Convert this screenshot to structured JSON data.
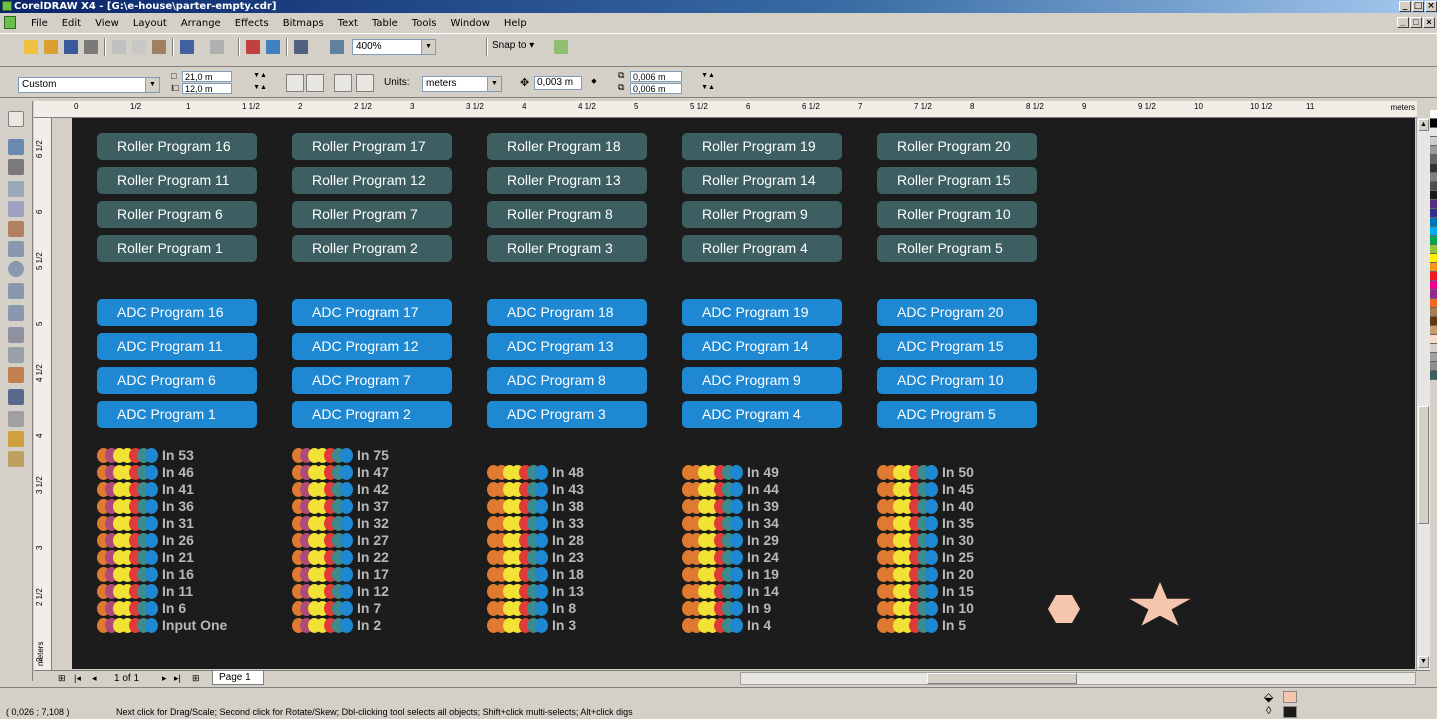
{
  "window": {
    "title": "CorelDRAW X4 - [G:\\e-house\\parter-empty.cdr]",
    "window_buttons": [
      "_",
      "□",
      "×"
    ]
  },
  "menu": [
    "File",
    "Edit",
    "View",
    "Layout",
    "Arrange",
    "Effects",
    "Bitmaps",
    "Text",
    "Table",
    "Tools",
    "Window",
    "Help"
  ],
  "toolbar": {
    "zoom": "400%",
    "snap_to": "Snap to"
  },
  "property_bar": {
    "paper_size": "Custom",
    "width": "21,0 m",
    "height": "12,0 m",
    "units_label": "Units:",
    "units_value": "meters",
    "nudge": "0,003 m",
    "dup_x": "0,006 m",
    "dup_y": "0,006 m"
  },
  "ruler": {
    "h_ticks": [
      "0",
      "1/2",
      "1",
      "1 1/2",
      "2",
      "2 1/2",
      "3",
      "3 1/2",
      "4",
      "4 1/2",
      "5",
      "5 1/2",
      "6",
      "6 1/2",
      "7",
      "7 1/2",
      "8",
      "8 1/2",
      "9",
      "9 1/2",
      "10",
      "10 1/2",
      "11"
    ],
    "units": "meters",
    "v_ticks": [
      "6 1/2",
      "6",
      "5 1/2",
      "5",
      "4 1/2",
      "4",
      "3 1/2",
      "3",
      "2 1/2",
      "2"
    ],
    "v_units": "meters"
  },
  "roller_rows": [
    [
      "Roller Program 16",
      "Roller Program 17",
      "Roller Program 18",
      "Roller Program 19",
      "Roller Program 20"
    ],
    [
      "Roller Program 11",
      "Roller Program 12",
      "Roller Program 13",
      "Roller Program 14",
      "Roller Program 15"
    ],
    [
      "Roller Program 6",
      "Roller Program 7",
      "Roller Program 8",
      "Roller Program 9",
      "Roller Program 10"
    ],
    [
      "Roller Program 1",
      "Roller Program 2",
      "Roller Program 3",
      "Roller Program 4",
      "Roller Program 5"
    ]
  ],
  "adc_rows": [
    [
      "ADC Program 16",
      "ADC Program 17",
      "ADC Program 18",
      "ADC Program 19",
      "ADC Program 20"
    ],
    [
      "ADC Program 11",
      "ADC Program 12",
      "ADC Program 13",
      "ADC Program 14",
      "ADC Program 15"
    ],
    [
      "ADC Program 6",
      "ADC Program 7",
      "ADC Program 8",
      "ADC Program 9",
      "ADC Program 10"
    ],
    [
      "ADC Program 1",
      "ADC Program 2",
      "ADC Program 3",
      "ADC Program 4",
      "ADC Program 5"
    ]
  ],
  "input_columns": [
    [
      "In 53",
      "In 46",
      "In 41",
      "In 36",
      "In 31",
      "In 26",
      "In 21",
      "In 16",
      "In 11",
      "In 6",
      "Input One"
    ],
    [
      "In 75",
      "In 47",
      "In 42",
      "In 37",
      "In 32",
      "In 27",
      "In 22",
      "In 17",
      "In 12",
      "In 7",
      "In 2"
    ],
    [
      "In 48",
      "In 43",
      "In 38",
      "In 33",
      "In 28",
      "In 23",
      "In 18",
      "In 13",
      "In 8",
      "In 3"
    ],
    [
      "In 49",
      "In 44",
      "In 39",
      "In 34",
      "In 29",
      "In 24",
      "In 19",
      "In 14",
      "In 9",
      "In 4"
    ],
    [
      "In 50",
      "In 45",
      "In 40",
      "In 35",
      "In 30",
      "In 25",
      "In 20",
      "In 15",
      "In 10",
      "In 5"
    ]
  ],
  "dot_colors_by_column": [
    [
      "#e07a30",
      "#b04a7a",
      "#f2e236",
      "#f2e236",
      "#e03a3a",
      "#3d8b8b",
      "#1e88d2"
    ],
    [
      "#e07a30",
      "#b04a7a",
      "#f2e236",
      "#f2e236",
      "#e03a3a",
      "#3d8b8b",
      "#1e88d2"
    ],
    [
      "#e07a30",
      "#e07a30",
      "#f2e236",
      "#f2e236",
      "#e03a3a",
      "#3d8b8b",
      "#1e88d2"
    ],
    [
      "#e07a30",
      "#e07a30",
      "#f2e236",
      "#f2e236",
      "#e03a3a",
      "#3d8b8b",
      "#1e88d2"
    ],
    [
      "#e07a30",
      "#e07a30",
      "#f2e236",
      "#f2e236",
      "#e03a3a",
      "#3d8b8b",
      "#1e88d2"
    ]
  ],
  "colors": {
    "canvas_bg": "#1c1c1c",
    "roller": "#3d5f61",
    "adc": "#1e88d2",
    "shape_fill": "#f5c5ad"
  },
  "palette": [
    "#ffffff",
    "#000000",
    "#e6e6e6",
    "#cccccc",
    "#999999",
    "#666666",
    "#333333",
    "#7f7f7f",
    "#4d4d4d",
    "#1a1a1a",
    "#5a2d82",
    "#2e3192",
    "#0072bc",
    "#00aeef",
    "#00a651",
    "#8dc63f",
    "#fff200",
    "#f7941d",
    "#ed1c24",
    "#ec008c",
    "#92278f",
    "#f26522",
    "#a67c52",
    "#603913",
    "#c69c6d",
    "#f9d9c8",
    "#d4d0c8",
    "#a0a0a0",
    "#8c8c8c",
    "#3d5f61"
  ],
  "navigation": {
    "page_count": "1 of 1",
    "page_tab": "Page 1"
  },
  "status": {
    "coords": "( 0,026 ; 7,108 )",
    "hint": "Next click for Drag/Scale; Second click for Rotate/Skew; Dbl-clicking tool selects all objects; Shift+click multi-selects; Alt+click digs"
  }
}
